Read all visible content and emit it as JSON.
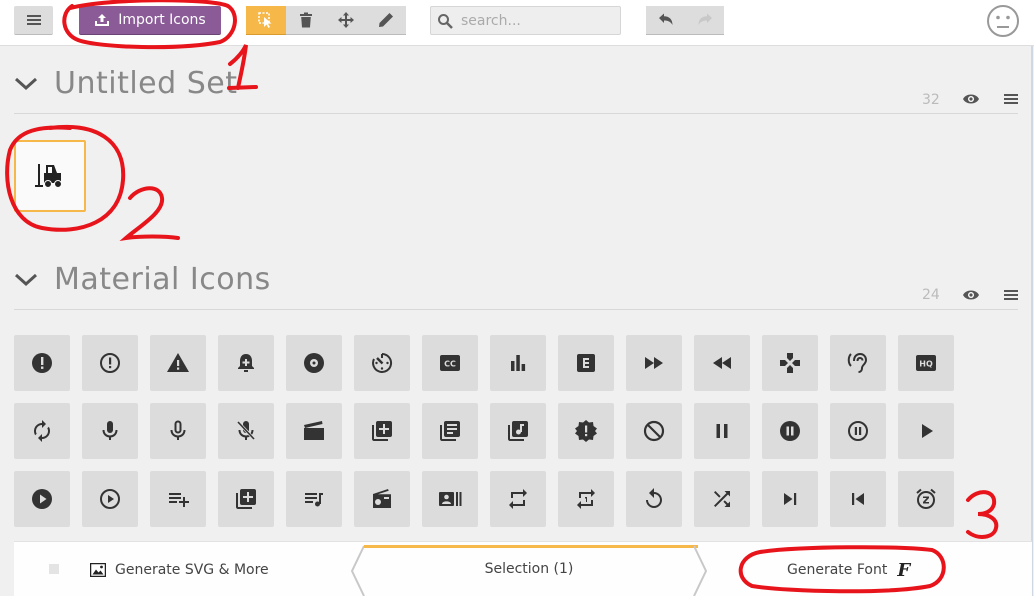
{
  "toolbar": {
    "import_label": "Import Icons",
    "search_placeholder": "search...",
    "icons": {
      "menu": "hamburger-menu-icon",
      "import": "upload-tray-icon",
      "select": "select-pointer-icon",
      "delete": "trash-icon",
      "move": "move-arrows-icon",
      "edit": "pencil-icon",
      "search": "magnifier-icon",
      "undo": "undo-icon",
      "redo": "redo-icon",
      "account": "neutral-face-icon"
    }
  },
  "sets": [
    {
      "title": "Untitled Set",
      "count": "32",
      "icons": [
        "forklift-icon"
      ]
    },
    {
      "title": "Material Icons",
      "count": "24"
    }
  ],
  "material_icons": [
    [
      "error",
      "error-outline",
      "warning",
      "add-alert",
      "album",
      "av-timer",
      "closed-caption",
      "equalizer",
      "explicit",
      "fast-forward",
      "fast-rewind",
      "games",
      "hearing",
      "high-quality"
    ],
    [
      "loop",
      "mic",
      "mic-none",
      "mic-off",
      "movie",
      "library-add",
      "library-books",
      "library-music",
      "new-releases",
      "not-interested",
      "pause",
      "pause-circle-filled",
      "pause-circle-outline",
      "play-arrow"
    ],
    [
      "play-circle-filled",
      "play-circle-outline",
      "playlist-add",
      "queue",
      "queue-music",
      "radio",
      "recent-actors",
      "repeat",
      "repeat-one",
      "replay",
      "shuffle",
      "skip-next",
      "skip-previous",
      "snooze"
    ]
  ],
  "bottom": {
    "generate_svg_label": "Generate SVG & More",
    "selection_label": "Selection (1)",
    "generate_font_label": "Generate Font",
    "font_glyph": "F"
  },
  "annotations": [
    "1",
    "2",
    "3"
  ],
  "colors": {
    "accent": "#f7b84a",
    "import_button": "#8a5b97",
    "annotation_red": "#e8141b"
  }
}
